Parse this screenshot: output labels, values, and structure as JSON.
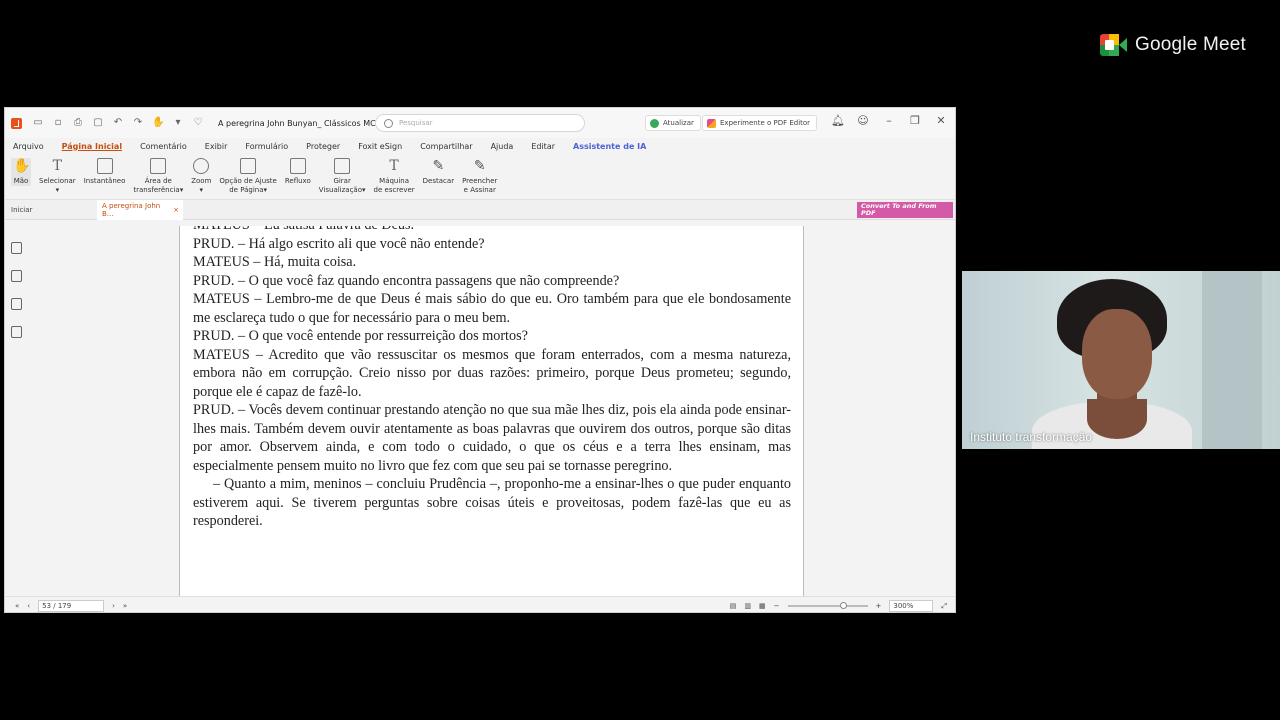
{
  "meet": {
    "brand": "Google Meet"
  },
  "window": {
    "title": "A peregrina John Bunyan_ Clássicos MC.pdf",
    "search_placeholder": "Pesquisar",
    "update_label": "Atualizar",
    "try_label": "Experimente o PDF Editor"
  },
  "menu": {
    "items": [
      "Arquivo",
      "Página Inicial",
      "Comentário",
      "Exibir",
      "Formulário",
      "Proteger",
      "Foxit eSign",
      "Compartilhar",
      "Ajuda",
      "Editar",
      "Assistente de IA"
    ]
  },
  "ribbon": {
    "tools": [
      {
        "line1": "Mão",
        "line2": ""
      },
      {
        "line1": "Selecionar",
        "line2": "▾"
      },
      {
        "line1": "Instantâneo",
        "line2": ""
      },
      {
        "line1": "Área de",
        "line2": "transferência▾"
      },
      {
        "line1": "Zoom",
        "line2": "▾"
      },
      {
        "line1": "Opção de Ajuste",
        "line2": "de Página▾"
      },
      {
        "line1": "Refluxo",
        "line2": ""
      },
      {
        "line1": "Girar",
        "line2": "Visualização▾"
      },
      {
        "line1": "Máquina",
        "line2": "de escrever"
      },
      {
        "line1": "Destacar",
        "line2": ""
      },
      {
        "line1": "Preencher",
        "line2": "e Assinar"
      }
    ]
  },
  "tabs": {
    "home": "Iniciar",
    "doc": "A peregrina John B...",
    "convert": "Convert To and From PDF"
  },
  "page": {
    "cut_line": "MATEUS – Eu satisa Palavra de Deus.",
    "paragraphs": [
      "PRUD. – Há algo escrito ali que você não entende?",
      "MATEUS – Há, muita coisa.",
      "PRUD. – O que você faz quando encontra passagens que não compreende?",
      "MATEUS – Lembro-me de que Deus é mais sábio do que eu. Oro também para que ele bondosamente me esclareça tudo o que for necessário para o meu bem.",
      "PRUD. – O que você entende por ressurreição dos mortos?",
      "MATEUS – Acredito que vão ressuscitar os mesmos que foram enterrados, com a mesma natureza, embora não em corrupção. Creio nisso por duas razões: primeiro, porque Deus prometeu; segundo, porque ele é capaz de fazê-lo.",
      "PRUD. – Vocês devem continuar prestando atenção no que sua mãe lhes diz, pois ela ainda pode ensinar-lhes mais. Também devem ouvir atentamente as boas palavras que ouvirem dos outros, porque são ditas por amor. Observem ainda, e com todo o cuidado, o que os céus e a terra lhes ensinam, mas especialmente pensem muito no livro que fez com que seu pai se tornasse peregrino.",
      "– Quanto a mim, meninos – concluiu Prudência –, proponho-me a ensinar-lhes o que puder enquanto estiverem aqui. Se tiverem perguntas sobre coisas úteis e proveitosas, podem fazê-las que eu as responderei."
    ]
  },
  "status": {
    "page_indicator": "53 / 179",
    "zoom": "300%"
  },
  "participant": {
    "name": "Instituto transformação"
  }
}
